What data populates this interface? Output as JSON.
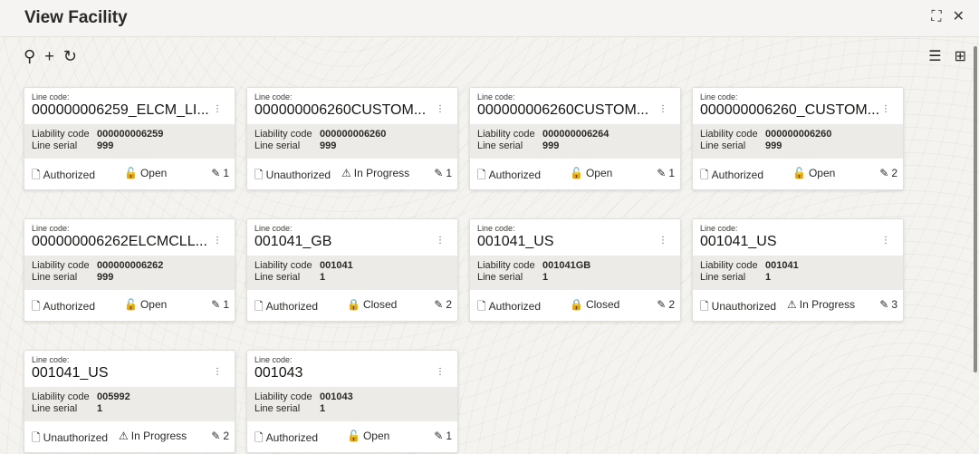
{
  "header": {
    "title": "View Facility"
  },
  "toolbar": {
    "search": "⚲",
    "add": "+",
    "refresh": "↻"
  },
  "view": {
    "list": "☰",
    "grid": "⊞"
  },
  "labels": {
    "line_code": "Line code:",
    "liability_code": "Liability code",
    "line_serial": "Line serial"
  },
  "cards": [
    {
      "line_code": "000000006259_ELCM_LI...",
      "liability_code": "000000006259",
      "line_serial": "999",
      "auth": "Authorized",
      "status": "Open",
      "edits": "1"
    },
    {
      "line_code": "000000006260CUSTOM...",
      "liability_code": "000000006260",
      "line_serial": "999",
      "auth": "Unauthorized",
      "status": "In Progress",
      "edits": "1"
    },
    {
      "line_code": "000000006260CUSTOM...",
      "liability_code": "000000006264",
      "line_serial": "999",
      "auth": "Authorized",
      "status": "Open",
      "edits": "1"
    },
    {
      "line_code": "000000006260_CUSTOM...",
      "liability_code": "000000006260",
      "line_serial": "999",
      "auth": "Authorized",
      "status": "Open",
      "edits": "2"
    },
    {
      "line_code": "000000006262ELCMCLL...",
      "liability_code": "000000006262",
      "line_serial": "999",
      "auth": "Authorized",
      "status": "Open",
      "edits": "1"
    },
    {
      "line_code": "001041_GB",
      "liability_code": "001041",
      "line_serial": "1",
      "auth": "Authorized",
      "status": "Closed",
      "edits": "2"
    },
    {
      "line_code": "001041_US",
      "liability_code": "001041GB",
      "line_serial": "1",
      "auth": "Authorized",
      "status": "Closed",
      "edits": "2"
    },
    {
      "line_code": "001041_US",
      "liability_code": "001041",
      "line_serial": "1",
      "auth": "Unauthorized",
      "status": "In Progress",
      "edits": "3"
    },
    {
      "line_code": "001041_US",
      "liability_code": "005992",
      "line_serial": "1",
      "auth": "Unauthorized",
      "status": "In Progress",
      "edits": "2"
    },
    {
      "line_code": "001043",
      "liability_code": "001043",
      "line_serial": "1",
      "auth": "Authorized",
      "status": "Open",
      "edits": "1"
    }
  ]
}
